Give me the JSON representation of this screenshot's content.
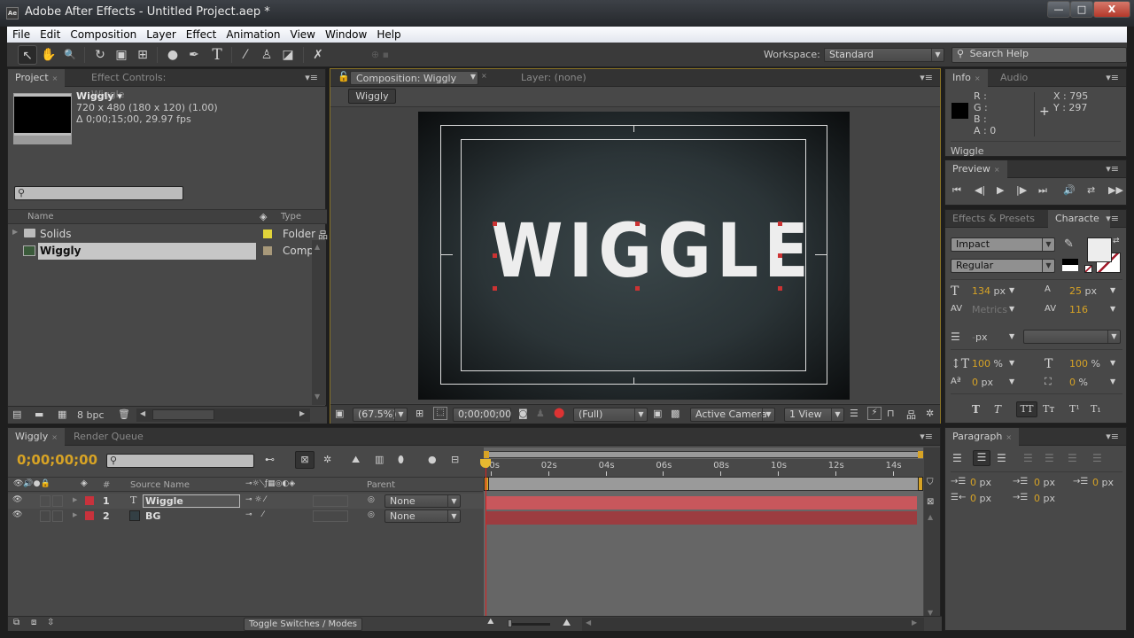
{
  "app": {
    "title": "Adobe After Effects - Untitled Project.aep *",
    "logo": "Ae",
    "window_controls": {
      "minimize": "—",
      "maximize": "□",
      "close": "X"
    }
  },
  "menu": [
    "File",
    "Edit",
    "Composition",
    "Layer",
    "Effect",
    "Animation",
    "View",
    "Window",
    "Help"
  ],
  "toolbar": {
    "tools": [
      {
        "name": "selection-tool-icon",
        "glyph": "↖",
        "active": true
      },
      {
        "name": "hand-tool-icon",
        "glyph": "✋"
      },
      {
        "name": "zoom-tool-icon",
        "glyph": "🔍"
      },
      {
        "name": "rotation-tool-icon",
        "glyph": "↻"
      },
      {
        "name": "camera-tool-icon",
        "glyph": "▣"
      },
      {
        "name": "pan-behind-tool-icon",
        "glyph": "⊞"
      },
      {
        "name": "shape-tool-icon",
        "glyph": "●"
      },
      {
        "name": "pen-tool-icon",
        "glyph": "✒"
      },
      {
        "name": "type-tool-icon",
        "glyph": "T"
      },
      {
        "name": "brush-tool-icon",
        "glyph": "⁄"
      },
      {
        "name": "clone-stamp-tool-icon",
        "glyph": "♙"
      },
      {
        "name": "eraser-tool-icon",
        "glyph": "◪"
      },
      {
        "name": "puppet-pin-tool-icon",
        "glyph": "✗"
      }
    ],
    "workspace_label": "Workspace:",
    "workspace_value": "Standard",
    "search_placeholder": "Search Help"
  },
  "project_panel": {
    "tabs": [
      {
        "label": "Project",
        "active": true
      },
      {
        "label": "Effect Controls: Wiggle",
        "active": false
      }
    ],
    "item_name": "Wiggly ▾",
    "item_size": "720 x 480  (180 x 120) (1.00)",
    "item_duration": "Δ 0;00;15;00, 29.97 fps",
    "search_value": "",
    "columns": {
      "name": "Name",
      "type": "Type"
    },
    "items": [
      {
        "name": "Solids",
        "type": "Folder",
        "label_color": "#e2d43a",
        "kind": "folder",
        "selected": false
      },
      {
        "name": "Wiggly",
        "type": "Compo",
        "label_color": "#a8997a",
        "kind": "composition",
        "selected": true
      }
    ],
    "bpc": "8 bpc"
  },
  "composition_panel": {
    "tabs": [
      {
        "label": "Composition: Wiggly",
        "active": true
      },
      {
        "label": "Layer: (none)",
        "active": false
      }
    ],
    "breadcrumb": "Wiggly",
    "canvas_text": "WIGGLE",
    "zoom": "(67.5%)",
    "timecode": "0;00;00;00",
    "resolution": "(Full)",
    "camera": "Active Camera",
    "views": "1 View"
  },
  "info_panel": {
    "tabs": [
      {
        "label": "Info",
        "active": true
      },
      {
        "label": "Audio",
        "active": false
      }
    ],
    "r": "R :",
    "g": "G :",
    "b": "B :",
    "a": "A :  0",
    "x": "X : 795",
    "y": "Y : 297",
    "layer": "Wiggle"
  },
  "preview_panel": {
    "tab": "Preview",
    "controls": [
      "first-frame",
      "previous-frame",
      "play",
      "next-frame",
      "last-frame",
      "audio",
      "loop",
      "ram-preview"
    ]
  },
  "character_panel": {
    "tabs": [
      {
        "label": "Effects & Presets",
        "active": false
      },
      {
        "label": "Characte",
        "active": true
      }
    ],
    "font_family": "Impact",
    "font_style": "Regular",
    "font_size": "134",
    "font_size_unit": "px",
    "leading": "25",
    "leading_unit": "px",
    "kerning": "Metrics",
    "tracking": "116",
    "stroke_width_unit": "px",
    "stroke_width": "-",
    "vertical_scale": "100",
    "horizontal_scale": "100",
    "baseline_shift": "0",
    "tsume": "0",
    "pct": "%",
    "px": "px",
    "fill_color": "#ededed",
    "style_buttons": [
      "T",
      "T",
      "TT",
      "Tт",
      "T¹",
      "T₁"
    ]
  },
  "paragraph_panel": {
    "tab": "Paragraph",
    "indent_left": "0",
    "indent_first": "0",
    "indent_right": "0",
    "space_before": "0",
    "space_after": "0",
    "unit": "px"
  },
  "timeline": {
    "tabs": [
      {
        "label": "Wiggly",
        "active": true
      },
      {
        "label": "Render Queue",
        "active": false
      }
    ],
    "timecode": "0;00;00;00",
    "search_value": "",
    "columns": {
      "num": "#",
      "source_name": "Source Name",
      "parent": "Parent"
    },
    "ruler_ticks": [
      "00s",
      "02s",
      "04s",
      "06s",
      "08s",
      "10s",
      "12s",
      "14s"
    ],
    "layers": [
      {
        "num": "1",
        "kind": "text",
        "name": "Wiggle",
        "label_color": "#c8323c",
        "parent": "None",
        "bar_color": "#c8575c"
      },
      {
        "num": "2",
        "kind": "solid",
        "name": "BG",
        "label_color": "#c8323c",
        "parent": "None",
        "bar_color": "#9c3c40"
      }
    ],
    "toggle_button": "Toggle Switches / Modes"
  }
}
